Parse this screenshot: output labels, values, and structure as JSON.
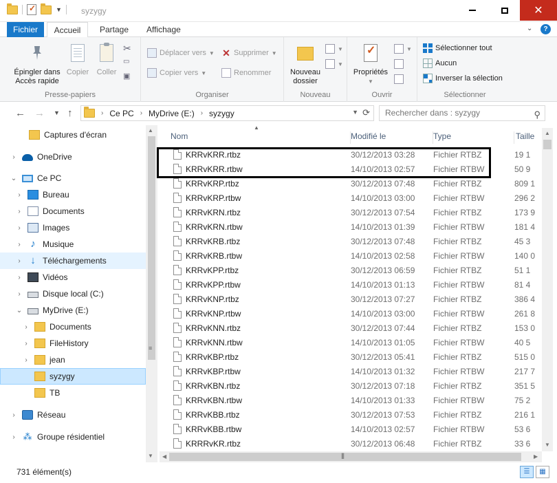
{
  "window": {
    "title": "syzygy"
  },
  "ribbon": {
    "tabs": {
      "file": "Fichier",
      "home": "Accueil",
      "share": "Partage",
      "view": "Affichage"
    },
    "clipboard": {
      "pin": "Épingler dans Accès rapide",
      "copy": "Copier",
      "paste": "Coller",
      "group": "Presse-papiers"
    },
    "organize": {
      "move_to": "Déplacer vers",
      "copy_to": "Copier vers",
      "delete": "Supprimer",
      "rename": "Renommer",
      "group": "Organiser"
    },
    "new": {
      "new_folder": "Nouveau dossier",
      "group": "Nouveau"
    },
    "open": {
      "properties": "Propriétés",
      "group": "Ouvrir"
    },
    "select": {
      "select_all": "Sélectionner tout",
      "none": "Aucun",
      "invert": "Inverser la sélection",
      "group": "Sélectionner"
    }
  },
  "address": {
    "crumbs": [
      "Ce PC",
      "MyDrive (E:)",
      "syzygy"
    ]
  },
  "search": {
    "placeholder": "Rechercher dans : syzygy"
  },
  "nav": {
    "items": [
      {
        "label": "Captures d'écran",
        "icon": "folder-icon"
      },
      {
        "label": "OneDrive",
        "icon": "onedrive-icon"
      },
      {
        "label": "Ce PC",
        "icon": "computer-icon"
      },
      {
        "label": "Bureau",
        "icon": "desktop-icon"
      },
      {
        "label": "Documents",
        "icon": "documents-icon"
      },
      {
        "label": "Images",
        "icon": "pictures-icon"
      },
      {
        "label": "Musique",
        "icon": "music-icon"
      },
      {
        "label": "Téléchargements",
        "icon": "downloads-icon"
      },
      {
        "label": "Vidéos",
        "icon": "videos-icon"
      },
      {
        "label": "Disque local (C:)",
        "icon": "drive-icon"
      },
      {
        "label": "MyDrive (E:)",
        "icon": "drive-icon"
      },
      {
        "label": "Documents",
        "icon": "folder-icon"
      },
      {
        "label": "FileHistory",
        "icon": "folder-icon"
      },
      {
        "label": "jean",
        "icon": "folder-icon"
      },
      {
        "label": "syzygy",
        "icon": "folder-icon"
      },
      {
        "label": "TB",
        "icon": "folder-icon"
      },
      {
        "label": "Réseau",
        "icon": "network-icon"
      },
      {
        "label": "Groupe résidentiel",
        "icon": "homegroup-icon"
      }
    ]
  },
  "columns": {
    "name": "Nom",
    "modified": "Modifié le",
    "type": "Type",
    "size": "Taille"
  },
  "files": [
    {
      "name": "KRRvKRR.rtbz",
      "date": "30/12/2013 03:28",
      "type": "Fichier RTBZ",
      "size": "19 1"
    },
    {
      "name": "KRRvKRR.rtbw",
      "date": "14/10/2013 02:57",
      "type": "Fichier RTBW",
      "size": "50 9"
    },
    {
      "name": "KRRvKRP.rtbz",
      "date": "30/12/2013 07:48",
      "type": "Fichier RTBZ",
      "size": "809 1"
    },
    {
      "name": "KRRvKRP.rtbw",
      "date": "14/10/2013 03:00",
      "type": "Fichier RTBW",
      "size": "296 2"
    },
    {
      "name": "KRRvKRN.rtbz",
      "date": "30/12/2013 07:54",
      "type": "Fichier RTBZ",
      "size": "173 9"
    },
    {
      "name": "KRRvKRN.rtbw",
      "date": "14/10/2013 01:39",
      "type": "Fichier RTBW",
      "size": "181 4"
    },
    {
      "name": "KRRvKRB.rtbz",
      "date": "30/12/2013 07:48",
      "type": "Fichier RTBZ",
      "size": "45 3"
    },
    {
      "name": "KRRvKRB.rtbw",
      "date": "14/10/2013 02:58",
      "type": "Fichier RTBW",
      "size": "140 0"
    },
    {
      "name": "KRRvKPP.rtbz",
      "date": "30/12/2013 06:59",
      "type": "Fichier RTBZ",
      "size": "51 1"
    },
    {
      "name": "KRRvKPP.rtbw",
      "date": "14/10/2013 01:13",
      "type": "Fichier RTBW",
      "size": "81 4"
    },
    {
      "name": "KRRvKNP.rtbz",
      "date": "30/12/2013 07:27",
      "type": "Fichier RTBZ",
      "size": "386 4"
    },
    {
      "name": "KRRvKNP.rtbw",
      "date": "14/10/2013 03:00",
      "type": "Fichier RTBW",
      "size": "261 8"
    },
    {
      "name": "KRRvKNN.rtbz",
      "date": "30/12/2013 07:44",
      "type": "Fichier RTBZ",
      "size": "153 0"
    },
    {
      "name": "KRRvKNN.rtbw",
      "date": "14/10/2013 01:05",
      "type": "Fichier RTBW",
      "size": "40 5"
    },
    {
      "name": "KRRvKBP.rtbz",
      "date": "30/12/2013 05:41",
      "type": "Fichier RTBZ",
      "size": "515 0"
    },
    {
      "name": "KRRvKBP.rtbw",
      "date": "14/10/2013 01:32",
      "type": "Fichier RTBW",
      "size": "217 7"
    },
    {
      "name": "KRRvKBN.rtbz",
      "date": "30/12/2013 07:18",
      "type": "Fichier RTBZ",
      "size": "351 5"
    },
    {
      "name": "KRRvKBN.rtbw",
      "date": "14/10/2013 01:33",
      "type": "Fichier RTBW",
      "size": "75 2"
    },
    {
      "name": "KRRvKBB.rtbz",
      "date": "30/12/2013 07:53",
      "type": "Fichier RTBZ",
      "size": "216 1"
    },
    {
      "name": "KRRvKBB.rtbw",
      "date": "14/10/2013 02:57",
      "type": "Fichier RTBW",
      "size": "53 6"
    },
    {
      "name": "KRRRvKR.rtbz",
      "date": "30/12/2013 06:48",
      "type": "Fichier RTBZ",
      "size": "33 6"
    }
  ],
  "status": {
    "count": "731 élément(s)"
  },
  "colors": {
    "accent": "#1979ca",
    "selection": "#cce8ff",
    "close": "#c42b1c"
  }
}
